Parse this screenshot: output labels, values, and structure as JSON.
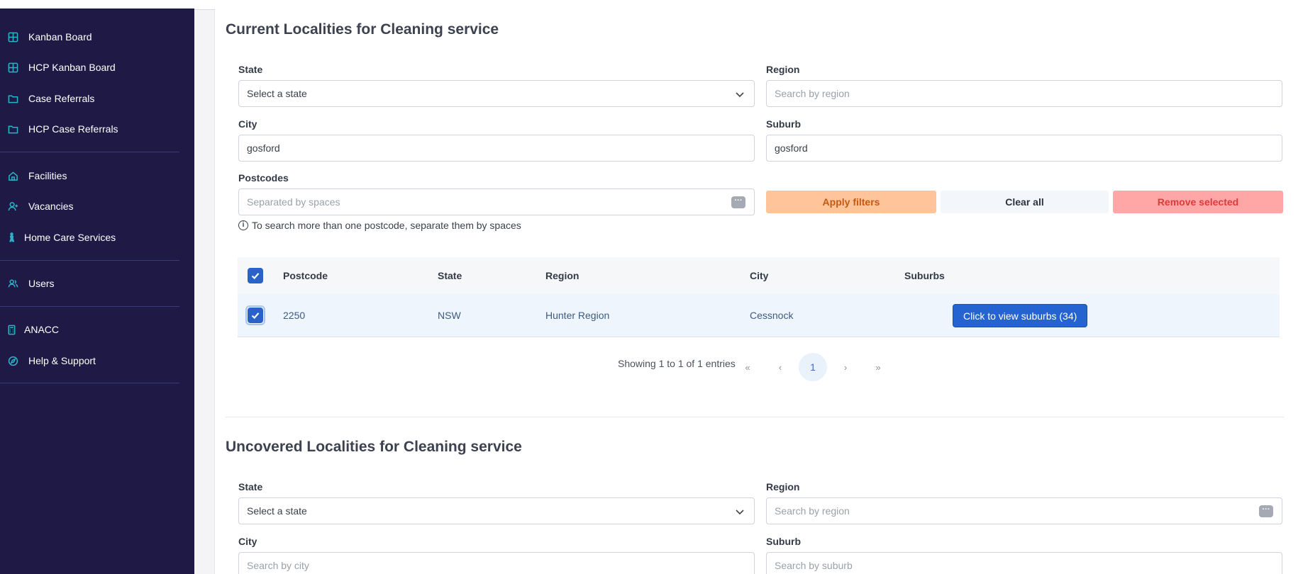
{
  "sidebar": {
    "items": [
      {
        "label": "Kanban Board",
        "icon": "grid-icon"
      },
      {
        "label": "HCP Kanban Board",
        "icon": "grid-icon"
      },
      {
        "label": "Case Referrals",
        "icon": "folder-icon"
      },
      {
        "label": "HCP Case Referrals",
        "icon": "folder-icon"
      },
      {
        "label": "Facilities",
        "icon": "home-icon"
      },
      {
        "label": "Vacancies",
        "icon": "user-add-icon"
      },
      {
        "label": "Home Care Services",
        "icon": "person-walking-icon"
      },
      {
        "label": "Users",
        "icon": "users-icon"
      },
      {
        "label": "ANACC",
        "icon": "calculator-icon"
      },
      {
        "label": "Help & Support",
        "icon": "compass-icon"
      }
    ]
  },
  "current": {
    "title": "Current Localities for Cleaning service",
    "state_label": "State",
    "state_value": "Select a state",
    "region_label": "Region",
    "region_placeholder": "Search by region",
    "city_label": "City",
    "city_value": "gosford",
    "suburb_label": "Suburb",
    "suburb_value": "gosford",
    "postcodes_label": "Postcodes",
    "postcodes_placeholder": "Separated by spaces",
    "apply_label": "Apply filters",
    "clear_label": "Clear all",
    "remove_label": "Remove selected",
    "hint": "To search more than one postcode, separate them by spaces",
    "table": {
      "headers": [
        "Postcode",
        "State",
        "Region",
        "City",
        "Suburbs"
      ],
      "rows": [
        {
          "postcode": "2250",
          "state": "NSW",
          "region": "Hunter Region",
          "city": "Cessnock",
          "suburbs_button": "Click to view suburbs (34)"
        }
      ]
    },
    "pagination": {
      "info": "Showing 1 to 1 of 1 entries",
      "first": "«",
      "prev": "‹",
      "page": "1",
      "next": "›",
      "last": "»"
    }
  },
  "uncovered": {
    "title": "Uncovered Localities for Cleaning service",
    "state_label": "State",
    "state_value": "Select a state",
    "region_label": "Region",
    "region_placeholder": "Search by region",
    "city_label": "City",
    "city_placeholder": "Search by city",
    "suburb_label": "Suburb",
    "suburb_placeholder": "Search by suburb"
  },
  "colors": {
    "sidebar_bg": "#1e1a45",
    "icon_accent": "#2bb3c8",
    "primary": "#2563d0",
    "apply_bg": "#ffc49a",
    "remove_bg": "#ffa6a6"
  }
}
